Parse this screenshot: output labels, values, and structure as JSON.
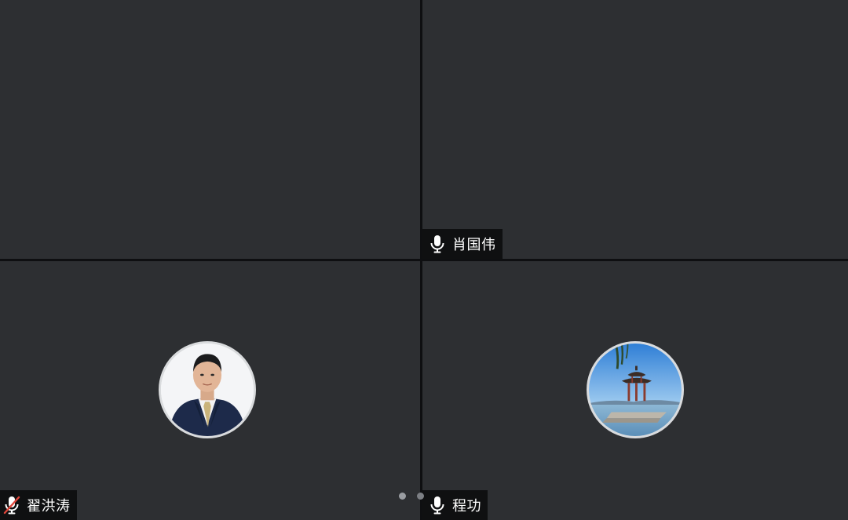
{
  "participants": [
    {
      "name": "",
      "mic_state": "none",
      "has_avatar": false
    },
    {
      "name": "肖国伟",
      "mic_state": "on",
      "has_avatar": false
    },
    {
      "name": "翟洪涛",
      "mic_state": "muted",
      "has_avatar": true,
      "avatar_subject": "man-in-suit-portrait"
    },
    {
      "name": "程功",
      "mic_state": "on",
      "has_avatar": true,
      "avatar_subject": "pavilion-by-lake"
    }
  ],
  "pager": {
    "pages": 2,
    "current_page": 1
  },
  "colors": {
    "tile_background": "#2d2f32",
    "divider": "#0e0f11",
    "name_tag_background": "#0a0a0c",
    "muted_slash": "#e0463b",
    "avatar_border": "#d9dbdd"
  },
  "icons": {
    "mic_on": "microphone-icon",
    "mic_muted": "microphone-muted-icon"
  }
}
